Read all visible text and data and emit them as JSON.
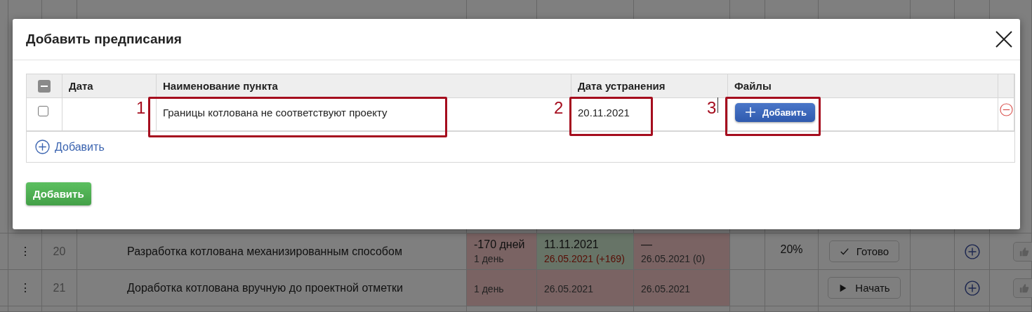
{
  "background_rows": [
    {
      "menu": "⋮",
      "number": "20",
      "name": "Разработка котлована механизированным способом",
      "days": "-170 дней",
      "days_sub": "1 день",
      "plan_date": "11.11.2021",
      "plan_date_sub": "26.05.2021 (+169)",
      "plan_ok": true,
      "overdue": true,
      "fact_date": "—",
      "fact_date_sub": "26.05.2021 (0)",
      "percent": "20%",
      "action": {
        "kind": "done",
        "label": "Готово"
      }
    },
    {
      "menu": "⋮",
      "number": "21",
      "name": "Доработка котлована вручную до проектной отметки",
      "days_sub": "1 день",
      "plan_date_sub": "26.05.2021",
      "plan_ok": false,
      "overdue": false,
      "fact_date_sub": "26.05.2021",
      "action": {
        "kind": "start",
        "label": "Начать"
      }
    }
  ],
  "dialog": {
    "title": "Добавить предписания",
    "table": {
      "select_all_partial": true,
      "columns": [
        "Дата",
        "Наименование пункта",
        "Дата устранения",
        "Файлы"
      ],
      "rows": [
        {
          "checked": false,
          "name_note": "1",
          "name": "Границы котлована не соответствуют проекту",
          "fix_date_note": "2",
          "fix_date": "20.11.2021",
          "files_note": "3",
          "files_button": "Добавить"
        }
      ],
      "add_link": "Добавить"
    },
    "submit_button": "Добавить"
  }
}
